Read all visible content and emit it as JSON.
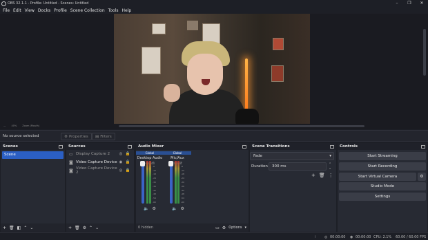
{
  "window": {
    "title": "OBS 32.1.1 - Profile: Untitled - Scenes: Untitled",
    "controls": [
      "–",
      "❐",
      "✕"
    ]
  },
  "menu": [
    "File",
    "Edit",
    "View",
    "Docks",
    "Profile",
    "Scene Collection",
    "Tools",
    "Help"
  ],
  "preview_status": {
    "left": "—",
    "zoom": "40%",
    "canvas": "Zoom (Mouth)"
  },
  "properties_bar": {
    "no_source": "No source selected",
    "properties_label": "Properties",
    "filters_label": "Filters"
  },
  "docks": {
    "scenes": {
      "title": "Scenes",
      "items": [
        "Scene"
      ]
    },
    "sources": {
      "title": "Sources",
      "items": [
        {
          "icon": "monitor-icon",
          "label": "Display Capture 2",
          "active": false
        },
        {
          "icon": "camera-icon",
          "label": "Video Capture Device",
          "active": true
        },
        {
          "icon": "camera-icon",
          "label": "Video Capture Device 2",
          "active": false
        }
      ]
    },
    "mixer": {
      "title": "Audio Mixer",
      "strips": [
        {
          "global": "Global",
          "name": "Desktop Audio",
          "db": "-0.0 dB"
        },
        {
          "global": "Global",
          "name": "Mic/Aux",
          "db": "0.0 dB"
        }
      ],
      "scale": [
        "0",
        "-6",
        "-12",
        "-18",
        "-24",
        "-30",
        "-36",
        "-42",
        "-48",
        "-54",
        "-60"
      ],
      "hidden": "0 hidden",
      "options": "Options"
    },
    "transitions": {
      "title": "Scene Transitions",
      "selected": "Fade",
      "duration_label": "Duration",
      "duration_value": "300 ms"
    },
    "controls": {
      "title": "Controls",
      "buttons": [
        "Start Streaming",
        "Start Recording",
        "Start Virtual Camera",
        "Studio Mode",
        "Settings"
      ]
    }
  },
  "statusbar": {
    "stream_time": "00:00:00",
    "rec_time": "00:00:00",
    "cpu": "CPU: 2.1%",
    "fps": "60.00 / 60.00 FPS"
  },
  "colors": {
    "accent": "#2b5fc4",
    "background": "#1d1f26",
    "panel": "#272a33"
  }
}
